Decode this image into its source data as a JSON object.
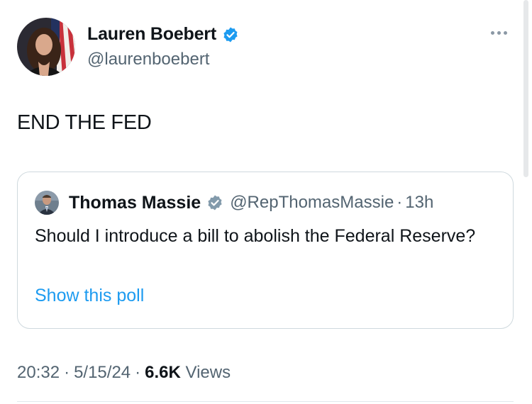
{
  "author": {
    "name": "Lauren Boebert",
    "handle": "@laurenboebert",
    "verified_color": "#1d9bf0"
  },
  "tweet": {
    "text": "END THE FED"
  },
  "quoted_tweet": {
    "name": "Thomas Massie",
    "handle": "@RepThomasMassie",
    "separator": "·",
    "time": "13h",
    "text": "Should I introduce a bill to abolish the Federal Reserve?",
    "poll_link": "Show this poll"
  },
  "meta": {
    "time": "20:32",
    "date": "5/15/24",
    "separator": "·",
    "views_count": "6.6K",
    "views_label": "Views"
  },
  "icons": {
    "more": "more-horizontal-icon",
    "verified": "verified-badge-icon"
  },
  "colors": {
    "text_primary": "#0f1419",
    "text_secondary": "#536471",
    "link": "#1d9bf0",
    "border": "#cfd9de"
  }
}
